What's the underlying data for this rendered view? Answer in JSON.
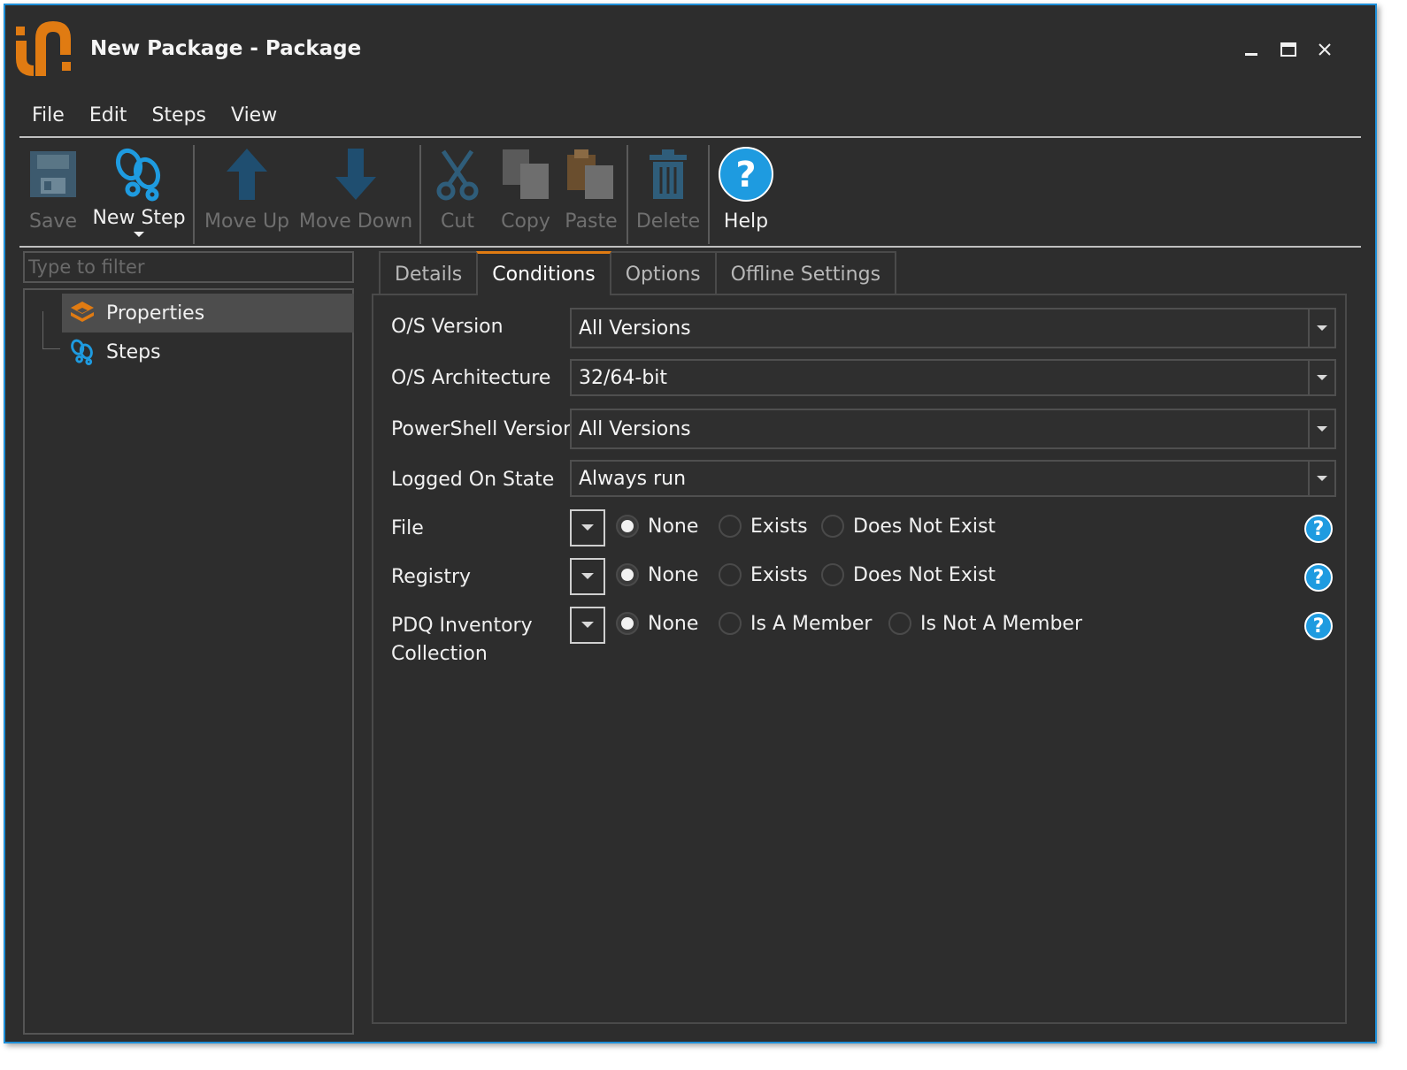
{
  "window": {
    "title": "New Package - Package",
    "accent_color": "#1e8fd8",
    "logo_color": "#e07b12"
  },
  "menu": [
    "File",
    "Edit",
    "Steps",
    "View"
  ],
  "toolbar": {
    "save": "Save",
    "new_step": "New Step",
    "move_up": "Move Up",
    "move_down": "Move Down",
    "cut": "Cut",
    "copy": "Copy",
    "paste": "Paste",
    "delete": "Delete",
    "help": "Help"
  },
  "sidebar": {
    "filter_placeholder": "Type to filter",
    "items": [
      {
        "label": "Properties",
        "icon": "package-icon",
        "selected": true
      },
      {
        "label": "Steps",
        "icon": "footsteps-icon",
        "selected": false
      }
    ]
  },
  "tabs": [
    {
      "label": "Details",
      "active": false
    },
    {
      "label": "Conditions",
      "active": true
    },
    {
      "label": "Options",
      "active": false
    },
    {
      "label": "Offline Settings",
      "active": false
    }
  ],
  "conditions": {
    "os_version": {
      "label": "O/S Version",
      "value": "All Versions"
    },
    "os_architecture": {
      "label": "O/S Architecture",
      "value": "32/64-bit"
    },
    "powershell_version": {
      "label": "PowerShell Version",
      "value": "All Versions"
    },
    "logged_on_state": {
      "label": "Logged On State",
      "value": "Always run"
    },
    "file": {
      "label": "File",
      "options": [
        "None",
        "Exists",
        "Does Not Exist"
      ],
      "selected": "None"
    },
    "registry": {
      "label": "Registry",
      "options": [
        "None",
        "Exists",
        "Does Not Exist"
      ],
      "selected": "None"
    },
    "pdq_collection": {
      "label_line1": "PDQ Inventory",
      "label_line2": "Collection",
      "options": [
        "None",
        "Is A Member",
        "Is Not A Member"
      ],
      "selected": "None"
    },
    "help_glyph": "?"
  }
}
